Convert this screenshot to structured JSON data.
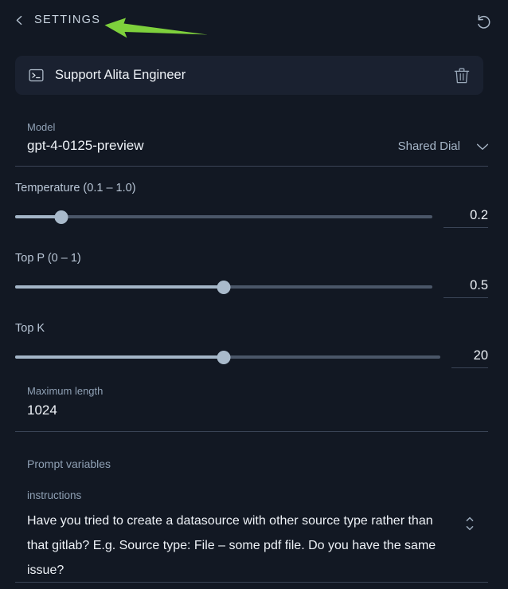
{
  "header": {
    "back_label": "SETTINGS",
    "back_icon": "chevron-left-icon",
    "reset_icon": "reset-rotate-icon"
  },
  "annotation": {
    "type": "arrow",
    "direction": "left",
    "color": "#7ed03c"
  },
  "agent_card": {
    "icon": "terminal-icon",
    "name": "Support Alita Engineer",
    "delete_icon": "trash-icon"
  },
  "model": {
    "label": "Model",
    "value": "gpt-4-0125-preview",
    "provider": "Shared Dial",
    "dropdown_icon": "chevron-down-icon"
  },
  "sliders": [
    {
      "label": "Temperature (0.1 – 1.0)",
      "value": "0.2",
      "percent": 11,
      "min": 0.1,
      "max": 1.0
    },
    {
      "label": "Top P (0 – 1)",
      "value": "0.5",
      "percent": 50,
      "min": 0,
      "max": 1
    },
    {
      "label": "Top K",
      "value": "20",
      "percent": 49,
      "min": 0,
      "max": 40
    }
  ],
  "max_length": {
    "label": "Maximum length",
    "value": "1024"
  },
  "prompt_variables": {
    "title": "Prompt variables",
    "key": "instructions",
    "text": "Have you tried to create a datasource with other source type rather than that gitlab? E.g. Source type: File – some pdf file. Do you have the same issue?",
    "resize_icon": "chevron-up-down-icon"
  },
  "colors": {
    "page_bg": "#121823",
    "card_bg": "#1a2130",
    "accent_green": "#7ed03c",
    "divider": "#3a4456",
    "track_filled": "#a3b5c7",
    "track_empty": "#4a5668",
    "text_primary": "#eef2f7",
    "text_muted": "#8fa0b4"
  }
}
